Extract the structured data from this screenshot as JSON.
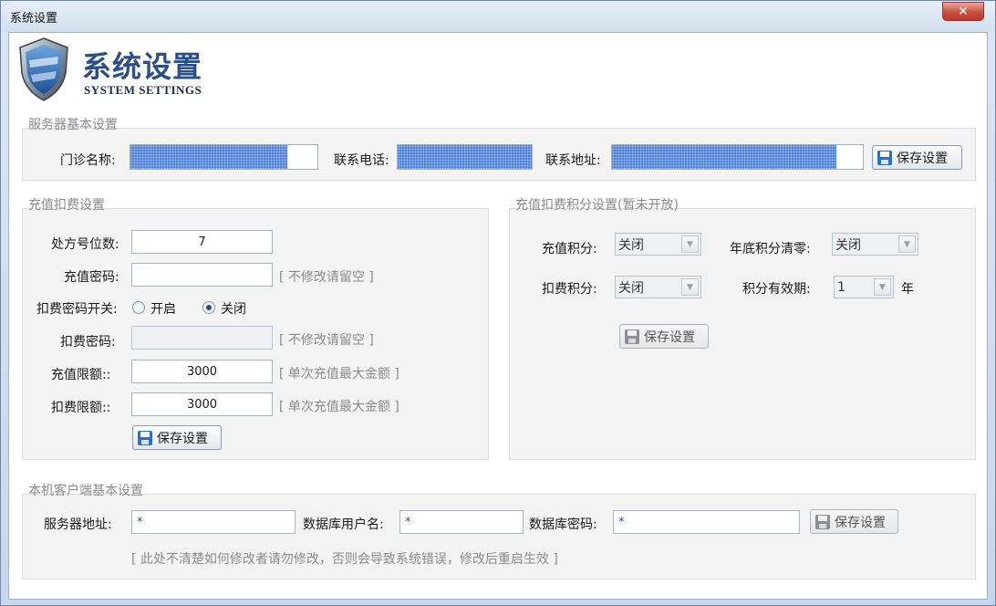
{
  "window": {
    "title": "系统设置",
    "close_glyph": "✕"
  },
  "header": {
    "title": "系统设置",
    "subtitle": "SYSTEM SETTINGS"
  },
  "server_basic": {
    "title": "服务器基本设置",
    "clinic_name_label": "门诊名称:",
    "phone_label": "联系电话:",
    "address_label": "联系地址:",
    "save_label": "保存设置"
  },
  "recharge": {
    "title": "充值扣费设置",
    "digits_label": "处方号位数:",
    "digits_value": "7",
    "recharge_pwd_label": "充值密码:",
    "recharge_pwd_value": "",
    "recharge_pwd_hint": "[ 不修改请留空 ]",
    "deduct_switch_label": "扣费密码开关:",
    "switch_on_label": "开启",
    "switch_off_label": "关闭",
    "switch_selected": "关闭",
    "deduct_pwd_label": "扣费密码:",
    "deduct_pwd_value": "",
    "deduct_pwd_hint": "[ 不修改请留空 ]",
    "recharge_limit_label": "充值限额::",
    "recharge_limit_value": "3000",
    "recharge_limit_hint": "[ 单次充值最大金额 ]",
    "deduct_limit_label": "扣费限额::",
    "deduct_limit_value": "3000",
    "deduct_limit_hint": "[ 单次充值最大金额 ]",
    "save_label": "保存设置"
  },
  "points": {
    "title": "充值扣费积分设置(暂未开放)",
    "recharge_points_label": "充值积分:",
    "recharge_points_value": "关闭",
    "yearend_clear_label": "年底积分清零:",
    "yearend_clear_value": "关闭",
    "deduct_points_label": "扣费积分:",
    "deduct_points_value": "关闭",
    "validity_label": "积分有效期:",
    "validity_value": "1",
    "validity_unit": "年",
    "save_label": "保存设置"
  },
  "client": {
    "title": "本机客户端基本设置",
    "server_addr_label": "服务器地址:",
    "server_addr_value": "*",
    "db_user_label": "数据库用户名:",
    "db_user_value": "*",
    "db_pwd_label": "数据库密码:",
    "db_pwd_value": "*",
    "save_label": "保存设置",
    "warning": "[ 此处不清楚如何修改者请勿修改，否则会导致系统错误，修改后重启生效 ]"
  }
}
